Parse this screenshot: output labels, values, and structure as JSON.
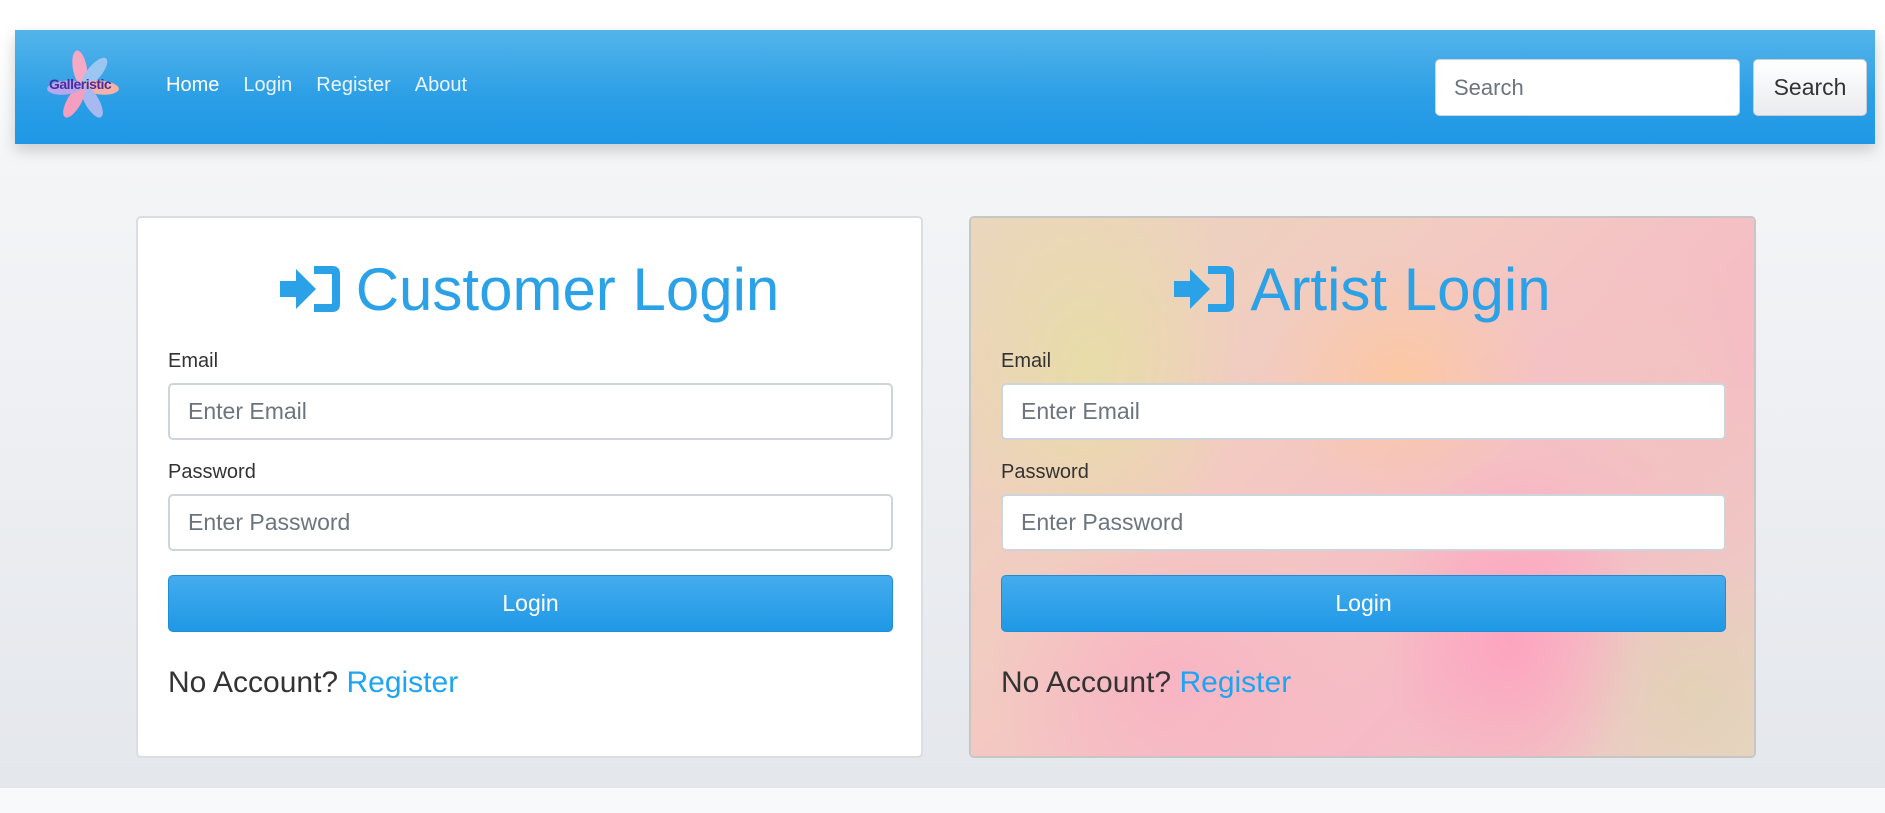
{
  "brand": {
    "logo_text": "Galleristic"
  },
  "nav": {
    "links": [
      {
        "label": "Home",
        "active": true
      },
      {
        "label": "Login"
      },
      {
        "label": "Register"
      },
      {
        "label": "About"
      }
    ]
  },
  "search": {
    "placeholder": "Search",
    "button_label": "Search"
  },
  "customer_login": {
    "title": "Customer Login",
    "email_label": "Email",
    "email_placeholder": "Enter Email",
    "password_label": "Password",
    "password_placeholder": "Enter Password",
    "login_label": "Login",
    "no_account_text": "No Account?",
    "register_label": "Register"
  },
  "artist_login": {
    "title": "Artist Login",
    "email_label": "Email",
    "email_placeholder": "Enter Email",
    "password_label": "Password",
    "password_placeholder": "Enter Password",
    "login_label": "Login",
    "no_account_text": "No Account?",
    "register_label": "Register"
  },
  "colors": {
    "navbar": "#2b9ee6",
    "accent": "#2ba1e7",
    "link": "#1fa4f3",
    "button": "#1f98e5"
  },
  "icons": {
    "login_icon": "sign-in-icon"
  }
}
